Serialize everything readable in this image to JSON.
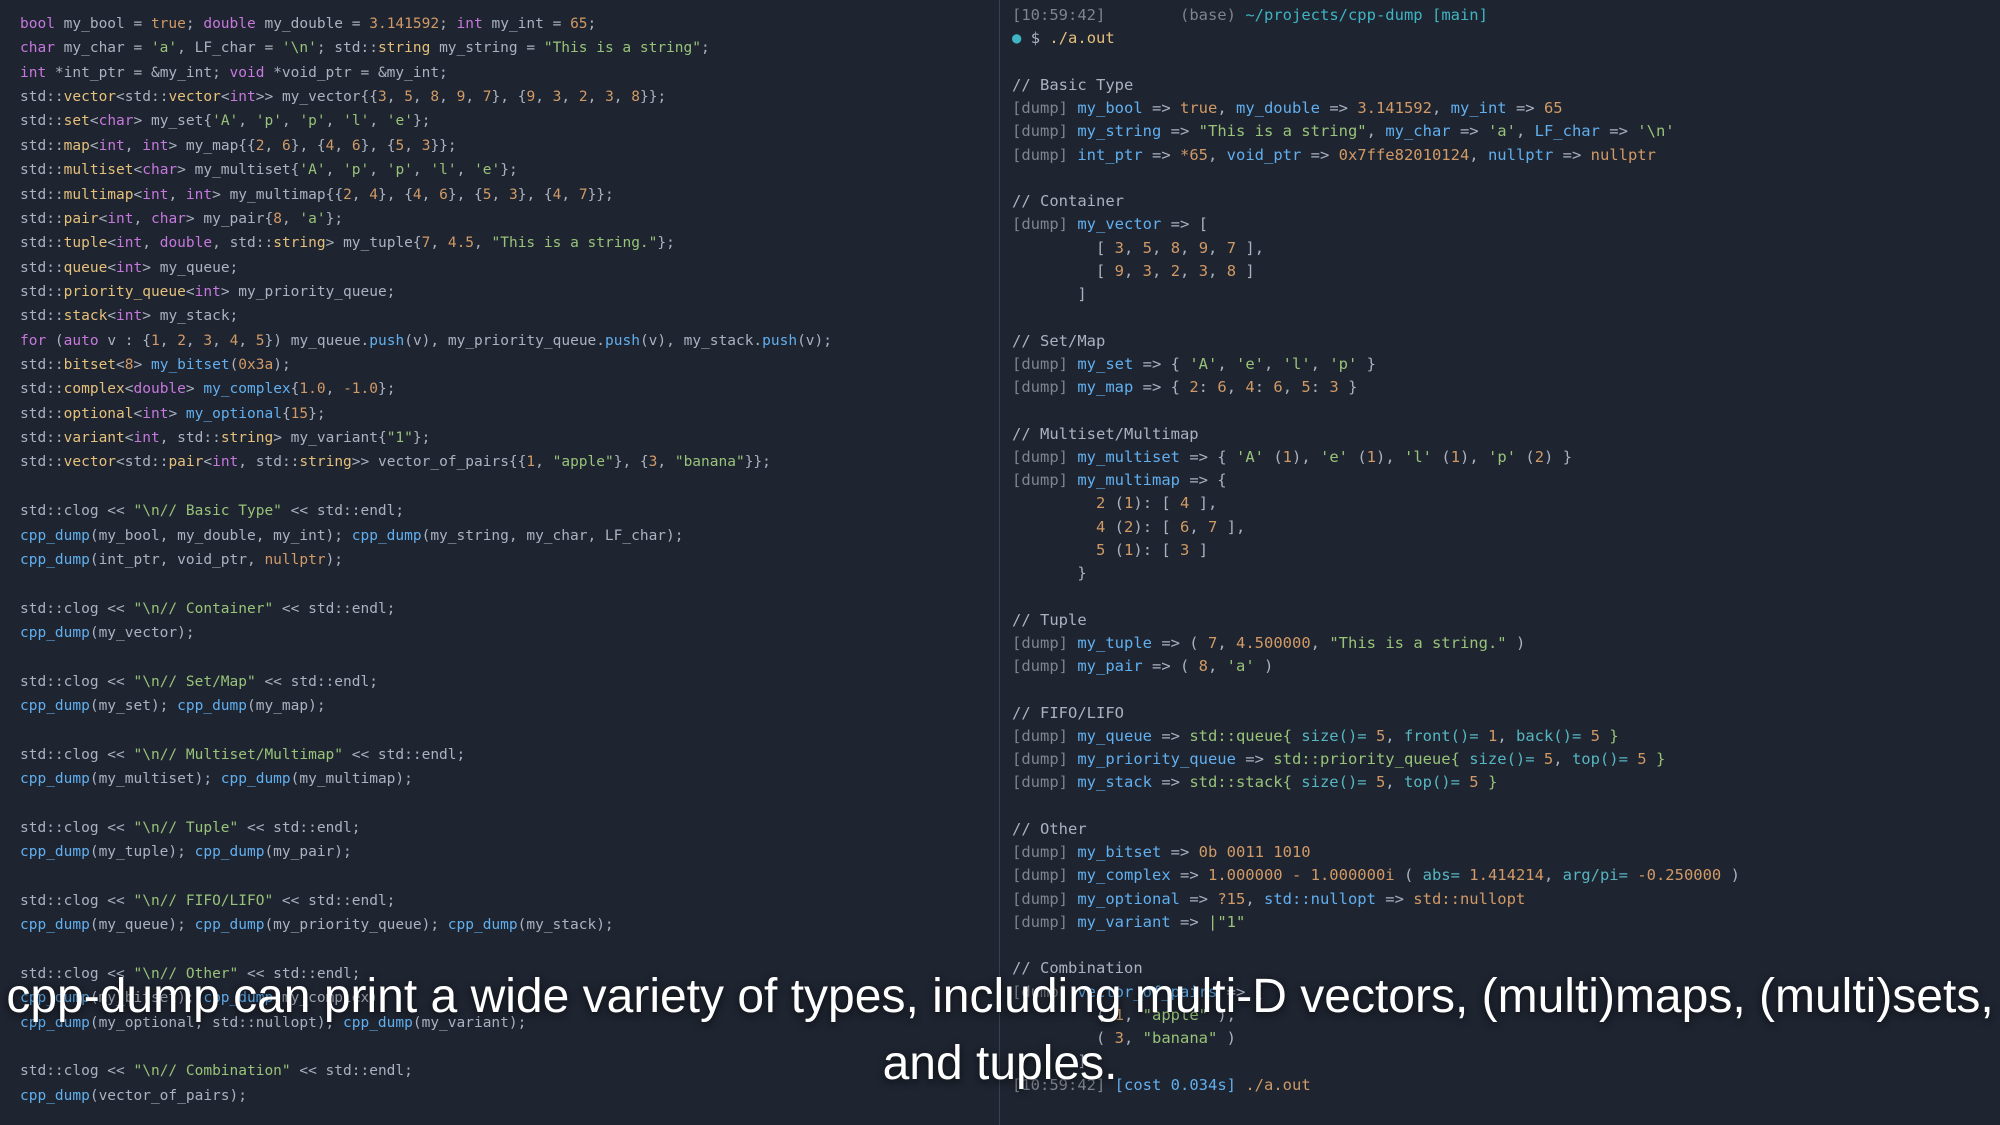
{
  "caption": "cpp-dump can print a wide variety of types, including multi-D vectors, (multi)maps, (multi)sets, and tuples.",
  "left": {
    "l1_a": "bool",
    "l1_b": " my_bool = ",
    "l1_c": "true",
    "l1_d": "; ",
    "l1_e": "double",
    "l1_f": " my_double = ",
    "l1_g": "3.141592",
    "l1_h": "; ",
    "l1_i": "int",
    "l1_j": " my_int = ",
    "l1_k": "65",
    "l1_l": ";",
    "l2_a": "char",
    "l2_b": " my_char = ",
    "l2_c": "'a'",
    "l2_d": ", LF_char = ",
    "l2_e": "'\\n'",
    "l2_f": "; std::",
    "l2_g": "string",
    "l2_h": " my_string = ",
    "l2_i": "\"This is a string\"",
    "l2_j": ";",
    "l3_a": "int",
    "l3_b": " *int_ptr = &my_int; ",
    "l3_c": "void",
    "l3_d": " *void_ptr = &my_int;",
    "l4_a": "std::",
    "l4_b": "vector",
    "l4_c": "<std::",
    "l4_d": "vector",
    "l4_e": "<",
    "l4_f": "int",
    "l4_g": ">> my_vector{{",
    "l4_h": "3",
    "l4_i": ", ",
    "l4_j": "5",
    "l4_k": ", ",
    "l4_l": "8",
    "l4_m": ", ",
    "l4_n": "9",
    "l4_o": ", ",
    "l4_p": "7",
    "l4_q": "}, {",
    "l4_r": "9",
    "l4_s": ", ",
    "l4_t": "3",
    "l4_u": ", ",
    "l4_v": "2",
    "l4_w": ", ",
    "l4_x": "3",
    "l4_y": ", ",
    "l4_z": "8",
    "l4_aa": "}};",
    "l5_a": "std::",
    "l5_b": "set",
    "l5_c": "<",
    "l5_d": "char",
    "l5_e": "> my_set{",
    "l5_f": "'A'",
    "l5_g": ", ",
    "l5_h": "'p'",
    "l5_i": ", ",
    "l5_j": "'p'",
    "l5_k": ", ",
    "l5_l": "'l'",
    "l5_m": ", ",
    "l5_n": "'e'",
    "l5_o": "};",
    "l6_a": "std::",
    "l6_b": "map",
    "l6_c": "<",
    "l6_d": "int",
    "l6_e": ", ",
    "l6_f": "int",
    "l6_g": "> my_map{{",
    "l6_h": "2",
    "l6_i": ", ",
    "l6_j": "6",
    "l6_k": "}, {",
    "l6_l": "4",
    "l6_m": ", ",
    "l6_n": "6",
    "l6_o": "}, {",
    "l6_p": "5",
    "l6_q": ", ",
    "l6_r": "3",
    "l6_s": "}};",
    "l7_a": "std::",
    "l7_b": "multiset",
    "l7_c": "<",
    "l7_d": "char",
    "l7_e": "> my_multiset{",
    "l7_f": "'A'",
    "l7_g": ", ",
    "l7_h": "'p'",
    "l7_i": ", ",
    "l7_j": "'p'",
    "l7_k": ", ",
    "l7_l": "'l'",
    "l7_m": ", ",
    "l7_n": "'e'",
    "l7_o": "};",
    "l8_a": "std::",
    "l8_b": "multimap",
    "l8_c": "<",
    "l8_d": "int",
    "l8_e": ", ",
    "l8_f": "int",
    "l8_g": "> my_multimap{{",
    "l8_h": "2",
    "l8_i": ", ",
    "l8_j": "4",
    "l8_k": "}, {",
    "l8_l": "4",
    "l8_m": ", ",
    "l8_n": "6",
    "l8_o": "}, {",
    "l8_p": "5",
    "l8_q": ", ",
    "l8_r": "3",
    "l8_s": "}, {",
    "l8_t": "4",
    "l8_u": ", ",
    "l8_v": "7",
    "l8_w": "}};",
    "l9_a": "std::",
    "l9_b": "pair",
    "l9_c": "<",
    "l9_d": "int",
    "l9_e": ", ",
    "l9_f": "char",
    "l9_g": "> my_pair{",
    "l9_h": "8",
    "l9_i": ", ",
    "l9_j": "'a'",
    "l9_k": "};",
    "l10_a": "std::",
    "l10_b": "tuple",
    "l10_c": "<",
    "l10_d": "int",
    "l10_e": ", ",
    "l10_f": "double",
    "l10_g": ", std::",
    "l10_h": "string",
    "l10_i": "> my_tuple{",
    "l10_j": "7",
    "l10_k": ", ",
    "l10_l": "4.5",
    "l10_m": ", ",
    "l10_n": "\"This is a string.\"",
    "l10_o": "};",
    "l11_a": "std::",
    "l11_b": "queue",
    "l11_c": "<",
    "l11_d": "int",
    "l11_e": "> my_queue;",
    "l12_a": "std::",
    "l12_b": "priority_queue",
    "l12_c": "<",
    "l12_d": "int",
    "l12_e": "> my_priority_queue;",
    "l13_a": "std::",
    "l13_b": "stack",
    "l13_c": "<",
    "l13_d": "int",
    "l13_e": "> my_stack;",
    "l14_a": "for",
    "l14_b": " (",
    "l14_c": "auto",
    "l14_d": " v : {",
    "l14_e": "1",
    "l14_f": ", ",
    "l14_g": "2",
    "l14_h": ", ",
    "l14_i": "3",
    "l14_j": ", ",
    "l14_k": "4",
    "l14_l": ", ",
    "l14_m": "5",
    "l14_n": "}) my_queue.",
    "l14_o": "push",
    "l14_p": "(v), my_priority_queue.",
    "l14_q": "push",
    "l14_r": "(v), my_stack.",
    "l14_s": "push",
    "l14_t": "(v);",
    "l15_a": "std::",
    "l15_b": "bitset",
    "l15_c": "<",
    "l15_d": "8",
    "l15_e": "> ",
    "l15_f": "my_bitset",
    "l15_g": "(",
    "l15_h": "0x3a",
    "l15_i": ");",
    "l16_a": "std::",
    "l16_b": "complex",
    "l16_c": "<",
    "l16_d": "double",
    "l16_e": "> ",
    "l16_f": "my_complex",
    "l16_g": "{",
    "l16_h": "1.0",
    "l16_i": ", ",
    "l16_j": "-1.0",
    "l16_k": "};",
    "l17_a": "std::",
    "l17_b": "optional",
    "l17_c": "<",
    "l17_d": "int",
    "l17_e": "> ",
    "l17_f": "my_optional",
    "l17_g": "{",
    "l17_h": "15",
    "l17_i": "};",
    "l18_a": "std::",
    "l18_b": "variant",
    "l18_c": "<",
    "l18_d": "int",
    "l18_e": ", std::",
    "l18_f": "string",
    "l18_g": "> my_variant{",
    "l18_h": "\"1\"",
    "l18_i": "};",
    "l19_a": "std::",
    "l19_b": "vector",
    "l19_c": "<std::",
    "l19_d": "pair",
    "l19_e": "<",
    "l19_f": "int",
    "l19_g": ", std::",
    "l19_h": "string",
    "l19_i": ">> vector_of_pairs{{",
    "l19_j": "1",
    "l19_k": ", ",
    "l19_l": "\"apple\"",
    "l19_m": "}, {",
    "l19_n": "3",
    "l19_o": ", ",
    "l19_p": "\"banana\"",
    "l19_q": "}};",
    "l20_a": "std::clog << ",
    "l20_b": "\"\\n// Basic Type\"",
    "l20_c": " << std::endl;",
    "l21_a": "cpp_dump",
    "l21_b": "(my_bool, my_double, my_int); ",
    "l21_c": "cpp_dump",
    "l21_d": "(my_string, my_char, LF_char);",
    "l22_a": "cpp_dump",
    "l22_b": "(int_ptr, void_ptr, ",
    "l22_c": "nullptr",
    "l22_d": ");",
    "l23_a": "std::clog << ",
    "l23_b": "\"\\n// Container\"",
    "l23_c": " << std::endl;",
    "l24_a": "cpp_dump",
    "l24_b": "(my_vector);",
    "l25_a": "std::clog << ",
    "l25_b": "\"\\n// Set/Map\"",
    "l25_c": " << std::endl;",
    "l26_a": "cpp_dump",
    "l26_b": "(my_set); ",
    "l26_c": "cpp_dump",
    "l26_d": "(my_map);",
    "l27_a": "std::clog << ",
    "l27_b": "\"\\n// Multiset/Multimap\"",
    "l27_c": " << std::endl;",
    "l28_a": "cpp_dump",
    "l28_b": "(my_multiset); ",
    "l28_c": "cpp_dump",
    "l28_d": "(my_multimap);",
    "l29_a": "std::clog << ",
    "l29_b": "\"\\n// Tuple\"",
    "l29_c": " << std::endl;",
    "l30_a": "cpp_dump",
    "l30_b": "(my_tuple); ",
    "l30_c": "cpp_dump",
    "l30_d": "(my_pair);",
    "l31_a": "std::clog << ",
    "l31_b": "\"\\n// FIFO/LIFO\"",
    "l31_c": " << std::endl;",
    "l32_a": "cpp_dump",
    "l32_b": "(my_queue); ",
    "l32_c": "cpp_dump",
    "l32_d": "(my_priority_queue); ",
    "l32_e": "cpp_dump",
    "l32_f": "(my_stack);",
    "l33_a": "std::clog << ",
    "l33_b": "\"\\n// Other\"",
    "l33_c": " << std::endl;",
    "l34_a": "cpp_dump",
    "l34_b": "(my_bitset); ",
    "l34_c": "cpp_dump",
    "l34_d": "(my_complex);",
    "l35_a": "cpp_dump",
    "l35_b": "(my_optional, std::nullopt); ",
    "l35_c": "cpp_dump",
    "l35_d": "(my_variant);",
    "l36_a": "std::clog << ",
    "l36_b": "\"\\n// Combination\"",
    "l36_c": " << std::endl;",
    "l37_a": "cpp_dump",
    "l37_b": "(vector_of_pairs);"
  },
  "right": {
    "time": "[10:59:42]",
    "base": "(base)",
    "path": "~/projects/cpp-dump",
    "branch": "[main]",
    "prompt": "$",
    "cmd": "./a.out",
    "s1": "// Basic Type",
    "r1_a": "[dump] ",
    "r1_b": "my_bool",
    "r1_c": " => ",
    "r1_d": "true",
    "r1_e": ", ",
    "r1_f": "my_double",
    "r1_g": " => ",
    "r1_h": "3.141592",
    "r1_i": ", ",
    "r1_j": "my_int",
    "r1_k": " => ",
    "r1_l": "65",
    "r2_a": "[dump] ",
    "r2_b": "my_string",
    "r2_c": " => ",
    "r2_d": "\"This is a string\"",
    "r2_e": ", ",
    "r2_f": "my_char",
    "r2_g": " => ",
    "r2_h": "'a'",
    "r2_i": ", ",
    "r2_j": "LF_char",
    "r2_k": " => ",
    "r2_l": "'\\n'",
    "r3_a": "[dump] ",
    "r3_b": "int_ptr",
    "r3_c": " => ",
    "r3_d": "*65",
    "r3_e": ", ",
    "r3_f": "void_ptr",
    "r3_g": " => ",
    "r3_h": "0x7ffe82010124",
    "r3_i": ", ",
    "r3_j": "nullptr",
    "r3_k": " => ",
    "r3_l": "nullptr",
    "s2": "// Container",
    "r4_a": "[dump] ",
    "r4_b": "my_vector",
    "r4_c": " => [",
    "r4_d": "         [ ",
    "r4_e": "3",
    "r4_f": ", ",
    "r4_g": "5",
    "r4_h": ", ",
    "r4_i": "8",
    "r4_j": ", ",
    "r4_k": "9",
    "r4_l": ", ",
    "r4_m": "7",
    "r4_n": " ],",
    "r4_o": "         [ ",
    "r4_p": "9",
    "r4_q": ", ",
    "r4_r": "3",
    "r4_s": ", ",
    "r4_t": "2",
    "r4_u": ", ",
    "r4_v": "3",
    "r4_w": ", ",
    "r4_x": "8",
    "r4_y": " ]",
    "r4_z": "       ]",
    "s3": "// Set/Map",
    "r5_a": "[dump] ",
    "r5_b": "my_set",
    "r5_c": " => { ",
    "r5_d": "'A'",
    "r5_e": ", ",
    "r5_f": "'e'",
    "r5_g": ", ",
    "r5_h": "'l'",
    "r5_i": ", ",
    "r5_j": "'p'",
    "r5_k": " }",
    "r6_a": "[dump] ",
    "r6_b": "my_map",
    "r6_c": " => { ",
    "r6_d": "2",
    "r6_e": ": ",
    "r6_f": "6",
    "r6_g": ", ",
    "r6_h": "4",
    "r6_i": ": ",
    "r6_j": "6",
    "r6_k": ", ",
    "r6_l": "5",
    "r6_m": ": ",
    "r6_n": "3",
    "r6_o": " }",
    "s4": "// Multiset/Multimap",
    "r7_a": "[dump] ",
    "r7_b": "my_multiset",
    "r7_c": " => { ",
    "r7_d": "'A'",
    "r7_e": " (",
    "r7_f": "1",
    "r7_g": "), ",
    "r7_h": "'e'",
    "r7_i": " (",
    "r7_j": "1",
    "r7_k": "), ",
    "r7_l": "'l'",
    "r7_m": " (",
    "r7_n": "1",
    "r7_o": "), ",
    "r7_p": "'p'",
    "r7_q": " (",
    "r7_r": "2",
    "r7_s": ") }",
    "r8_a": "[dump] ",
    "r8_b": "my_multimap",
    "r8_c": " => {",
    "r8_d": "         ",
    "r8_e": "2",
    "r8_f": " (",
    "r8_g": "1",
    "r8_h": "): [ ",
    "r8_i": "4",
    "r8_j": " ],",
    "r8_k": "         ",
    "r8_l": "4",
    "r8_m": " (",
    "r8_n": "2",
    "r8_o": "): [ ",
    "r8_p": "6",
    "r8_q": ", ",
    "r8_r": "7",
    "r8_s": " ],",
    "r8_t": "         ",
    "r8_u": "5",
    "r8_v": " (",
    "r8_w": "1",
    "r8_x": "): [ ",
    "r8_y": "3",
    "r8_z": " ]",
    "r8_aa": "       }",
    "s5": "// Tuple",
    "r9_a": "[dump] ",
    "r9_b": "my_tuple",
    "r9_c": " => ( ",
    "r9_d": "7",
    "r9_e": ", ",
    "r9_f": "4.500000",
    "r9_g": ", ",
    "r9_h": "\"This is a string.\"",
    "r9_i": " )",
    "r10_a": "[dump] ",
    "r10_b": "my_pair",
    "r10_c": " => ( ",
    "r10_d": "8",
    "r10_e": ", ",
    "r10_f": "'a'",
    "r10_g": " )",
    "s6": "// FIFO/LIFO",
    "r11_a": "[dump] ",
    "r11_b": "my_queue",
    "r11_c": " => ",
    "r11_d": "std::queue{ ",
    "r11_e": "size()= ",
    "r11_f": "5",
    "r11_g": ", ",
    "r11_h": "front()= ",
    "r11_i": "1",
    "r11_j": ", ",
    "r11_k": "back()= ",
    "r11_l": "5",
    "r11_m": " }",
    "r12_a": "[dump] ",
    "r12_b": "my_priority_queue",
    "r12_c": " => ",
    "r12_d": "std::priority_queue{ ",
    "r12_e": "size()= ",
    "r12_f": "5",
    "r12_g": ", ",
    "r12_h": "top()= ",
    "r12_i": "5",
    "r12_j": " }",
    "r13_a": "[dump] ",
    "r13_b": "my_stack",
    "r13_c": " => ",
    "r13_d": "std::stack{ ",
    "r13_e": "size()= ",
    "r13_f": "5",
    "r13_g": ", ",
    "r13_h": "top()= ",
    "r13_i": "5",
    "r13_j": " }",
    "s7": "// Other",
    "r14_a": "[dump] ",
    "r14_b": "my_bitset",
    "r14_c": " => ",
    "r14_d": "0b 0011 1010",
    "r15_a": "[dump] ",
    "r15_b": "my_complex",
    "r15_c": " => ",
    "r15_d": "1.000000 - 1.000000i",
    "r15_e": " ( ",
    "r15_f": "abs= ",
    "r15_g": "1.414214",
    "r15_h": ", ",
    "r15_i": "arg/pi= ",
    "r15_j": "-0.250000",
    "r15_k": " )",
    "r16_a": "[dump] ",
    "r16_b": "my_optional",
    "r16_c": " => ",
    "r16_d": "?15",
    "r16_e": ", ",
    "r16_f": "std::nullopt",
    "r16_g": " => ",
    "r16_h": "std::nullopt",
    "r17_a": "[dump] ",
    "r17_b": "my_variant",
    "r17_c": " => ",
    "r17_d": "|\"1\"",
    "s8": "// Combination",
    "r18_a": "[dump] ",
    "r18_b": "vector_of_pairs",
    "r18_c": " => [",
    "r18_d": "         ( ",
    "r18_e": "1",
    "r18_f": ", ",
    "r18_g": "\"apple\"",
    "r18_h": " ),",
    "r18_i": "         ( ",
    "r18_j": "3",
    "r18_k": ", ",
    "r18_l": "\"banana\"",
    "r18_m": " )",
    "r18_n": "       ]",
    "time2": "[10:59:42]",
    "cost": "[cost 0.034s]",
    "cmd2": "./a.out"
  }
}
